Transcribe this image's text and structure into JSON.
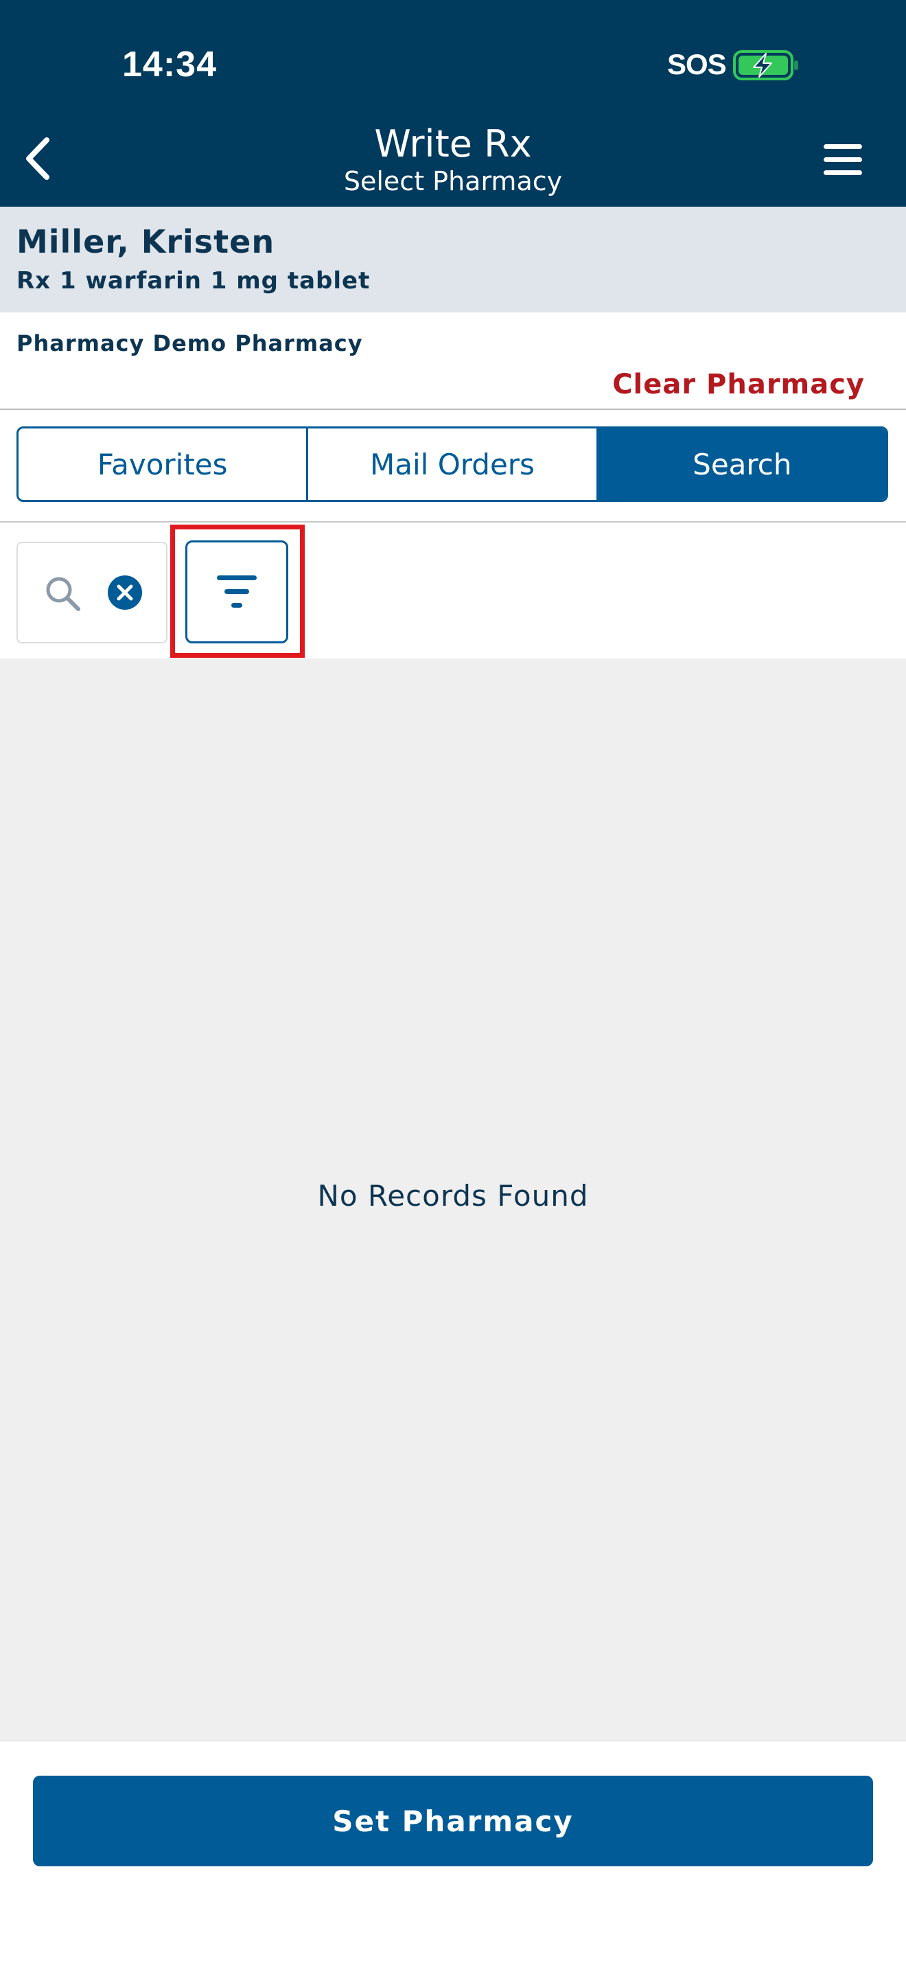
{
  "status_bar": {
    "time": "14:34",
    "carrier": "SOS",
    "battery_icon": "battery-charging-icon",
    "battery_color": "#34c759"
  },
  "header": {
    "title": "Write Rx",
    "subtitle": "Select Pharmacy",
    "back_icon": "chevron-left-icon",
    "menu_icon": "hamburger-menu-icon",
    "background": "#003a5c"
  },
  "patient": {
    "name": "Miller, Kristen",
    "rx": "Rx 1 warfarin 1 mg tablet"
  },
  "pharmacy": {
    "label": "Pharmacy Demo Pharmacy",
    "clear_label": "Clear Pharmacy",
    "clear_color": "#b3191f"
  },
  "tabs": [
    {
      "label": "Favorites",
      "active": false
    },
    {
      "label": "Mail Orders",
      "active": false
    },
    {
      "label": "Search",
      "active": true
    }
  ],
  "search": {
    "value": "",
    "search_icon": "search-icon",
    "clear_icon": "clear-circle-icon",
    "filter_icon": "filter-icon"
  },
  "results": {
    "empty_message": "No Records Found"
  },
  "footer": {
    "set_label": "Set Pharmacy",
    "accent": "#005b96"
  }
}
